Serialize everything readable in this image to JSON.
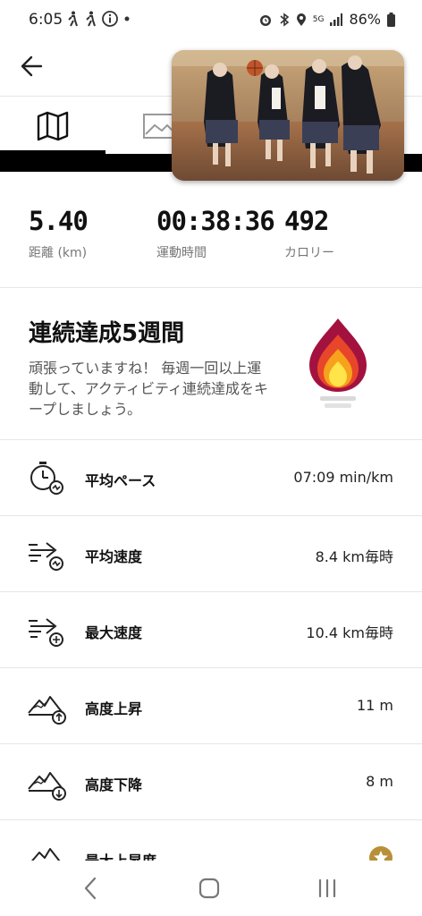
{
  "status_bar": {
    "time": "6:05",
    "signal_label": "5G",
    "battery": "86%"
  },
  "tabs": [
    {
      "id": "map",
      "icon": "map-icon",
      "selected": true
    },
    {
      "id": "photo",
      "icon": "image-icon",
      "selected": false
    }
  ],
  "stats": [
    {
      "value": "5.40",
      "label": "距離 (km)"
    },
    {
      "value": "00:38:36",
      "label": "運動時間"
    },
    {
      "value": "492",
      "label": "カロリー"
    }
  ],
  "streak": {
    "title": "連続達成5週間",
    "description": "頑張っていますね！ 毎週一回以上運動して、アクティビティ連続達成をキープしましょう。",
    "icon": "flame-icon",
    "colors": [
      "#a3123f",
      "#e8462a",
      "#f6a21c",
      "#ffe44a"
    ]
  },
  "metrics": [
    {
      "label": "平均ペース",
      "value": "07:09 min/km",
      "icon": "pace-icon"
    },
    {
      "label": "平均速度",
      "value": "8.4 km毎時",
      "icon": "avg-speed-icon"
    },
    {
      "label": "最大速度",
      "value": "10.4 km毎時",
      "icon": "max-speed-icon"
    },
    {
      "label": "高度上昇",
      "value": "11 m",
      "icon": "elevation-gain-icon"
    },
    {
      "label": "高度下降",
      "value": "8 m",
      "icon": "elevation-loss-icon"
    },
    {
      "label": "最大上昇度",
      "value": "",
      "icon": "max-elevation-icon"
    }
  ],
  "nav": [
    "back-icon",
    "home-icon",
    "recents-icon"
  ]
}
